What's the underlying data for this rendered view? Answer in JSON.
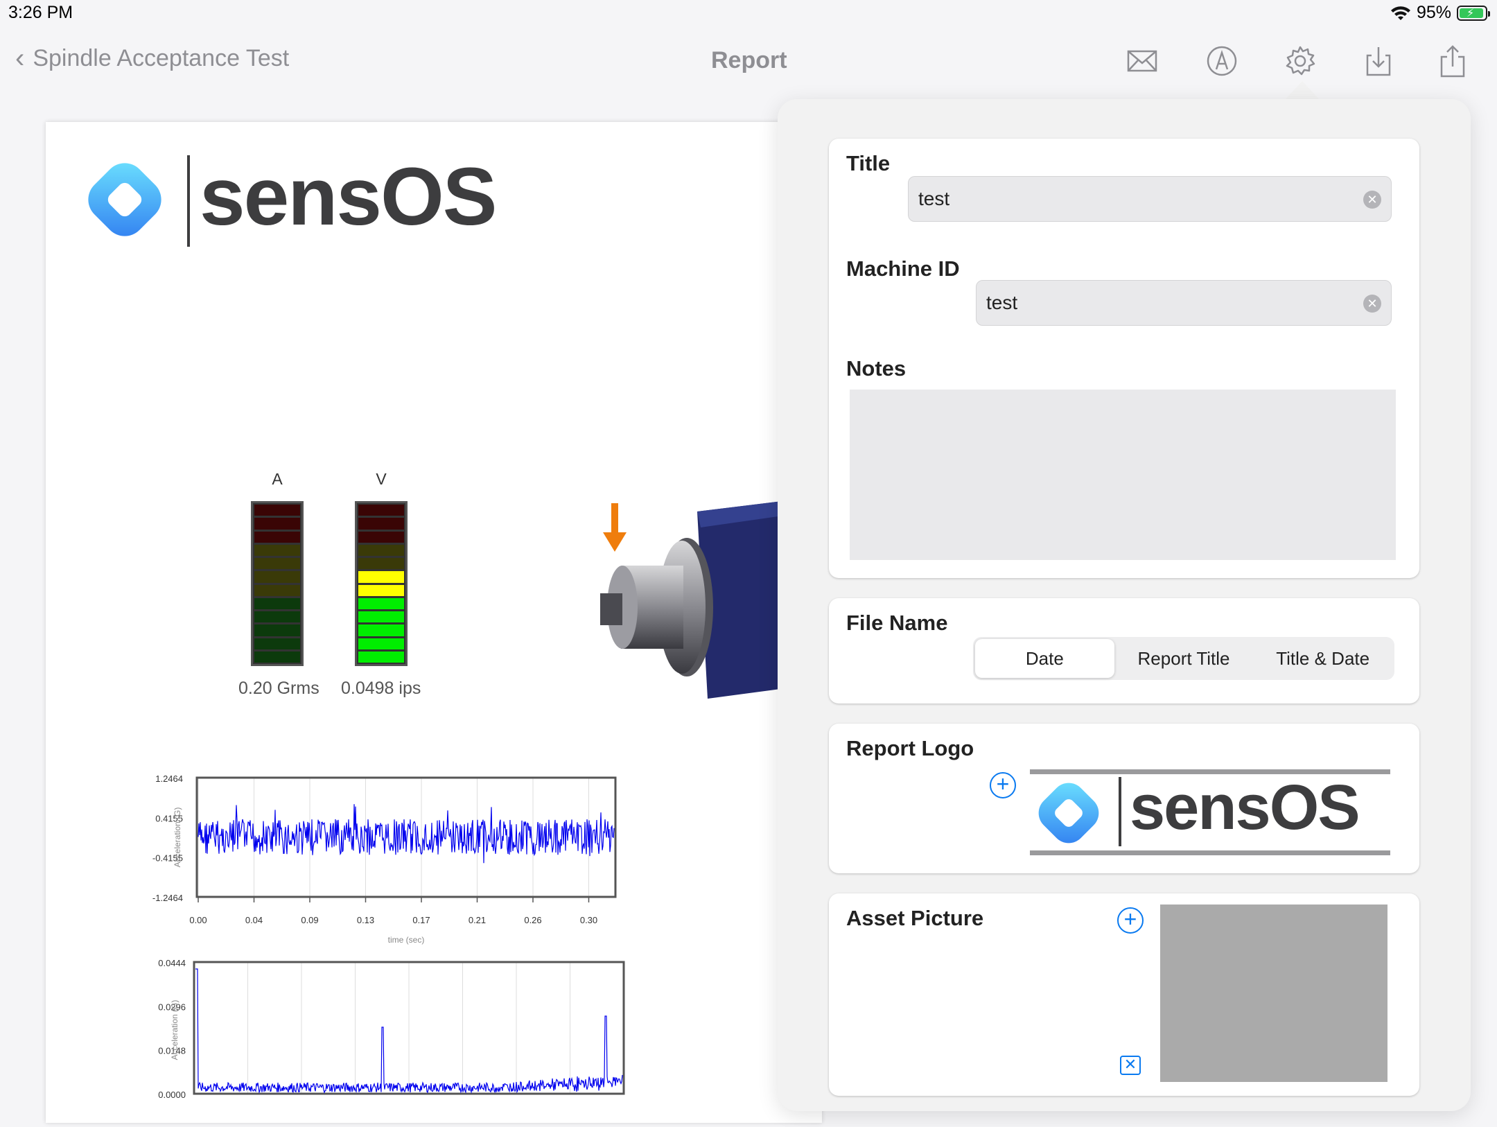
{
  "status_bar": {
    "time": "3:26 PM",
    "battery": "95%",
    "battery_level": 0.95
  },
  "nav": {
    "back_label": "Spindle Acceptance Test",
    "title": "Report",
    "icons": [
      "envelope-icon",
      "markup-pen-icon",
      "gear-icon",
      "download-icon",
      "share-icon"
    ]
  },
  "report": {
    "logo_text": "sensOS",
    "meters": [
      {
        "label": "A",
        "value": "0.20 Grms",
        "level_segments": 0
      },
      {
        "label": "V",
        "value": "0.0498 ips",
        "level_segments": 7
      }
    ],
    "time_chart": {
      "y_ticks": [
        "1.2464",
        "0.4155",
        "-0.4155",
        "-1.2464"
      ],
      "x_ticks": [
        "0.00",
        "0.04",
        "0.09",
        "0.13",
        "0.17",
        "0.21",
        "0.26",
        "0.30"
      ],
      "xlabel": "time (sec)",
      "ylabel": "Acceleration (G)"
    },
    "spectrum_chart": {
      "y_ticks": [
        "0.0444",
        "0.0296",
        "0.0148",
        "0.0000"
      ],
      "ylabel": "Acceleration (G)"
    }
  },
  "settings": {
    "title_label": "Title",
    "title_value": "test",
    "machine_label": "Machine ID",
    "machine_value": "test",
    "notes_label": "Notes",
    "filename_label": "File Name",
    "filename_options": [
      "Date",
      "Report Title",
      "Title & Date"
    ],
    "filename_selected": "Date",
    "logo_label": "Report Logo",
    "logo_text": "sensOS",
    "asset_label": "Asset Picture"
  },
  "colors": {
    "accent": "#0a7af0",
    "signal": "#0000ee",
    "meter_green": "#00ee00",
    "meter_yellow": "#ffff00",
    "logo_blue": "#2f9bf0",
    "logo_cyan": "#6fe6ff"
  }
}
